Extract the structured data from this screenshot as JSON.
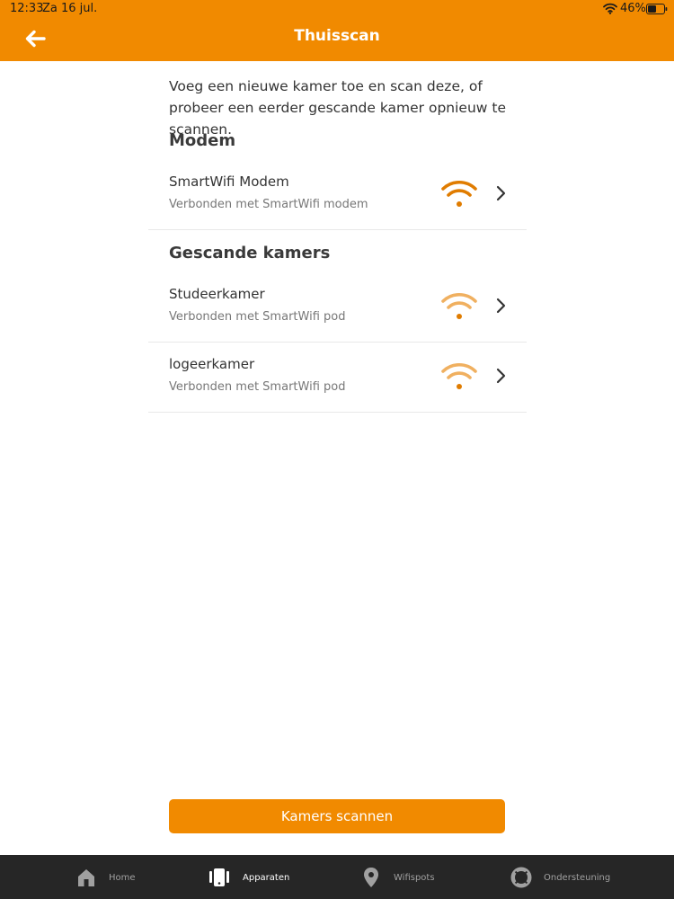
{
  "status_bar": {
    "time": "12:33",
    "date": "Za 16 jul.",
    "battery": "46%"
  },
  "header": {
    "title": "Thuisscan",
    "back_icon": "arrow-left-icon"
  },
  "intro": "Voeg een nieuwe kamer toe en scan deze, of probeer een eerder gescande kamer opnieuw te scannen.",
  "modem_section": {
    "heading": "Modem",
    "items": [
      {
        "title": "SmartWifi Modem",
        "subtitle": "Verbonden met SmartWifi modem",
        "signal_icon": "wifi-strong-icon",
        "signal_color": "#e07c00"
      }
    ]
  },
  "rooms_section": {
    "heading": "Gescande kamers",
    "items": [
      {
        "title": "Studeerkamer",
        "subtitle": "Verbonden met SmartWifi pod",
        "signal_icon": "wifi-medium-icon",
        "signal_color": "#f0b060"
      },
      {
        "title": "logeerkamer",
        "subtitle": "Verbonden met SmartWifi pod",
        "signal_icon": "wifi-medium-icon",
        "signal_color": "#f0b060"
      }
    ]
  },
  "scan_button": {
    "label": "Kamers scannen"
  },
  "tabbar": {
    "tabs": [
      {
        "label": "Home",
        "icon": "home-icon",
        "active": false
      },
      {
        "label": "Apparaten",
        "icon": "devices-icon",
        "active": true
      },
      {
        "label": "Wifispots",
        "icon": "location-pin-icon",
        "active": false
      },
      {
        "label": "Ondersteuning",
        "icon": "lifebuoy-icon",
        "active": false
      }
    ]
  },
  "colors": {
    "brand": "#f18a00",
    "tabbar": "#262626",
    "wifi_strong": "#e07c00",
    "wifi_medium": "#f0b060"
  }
}
